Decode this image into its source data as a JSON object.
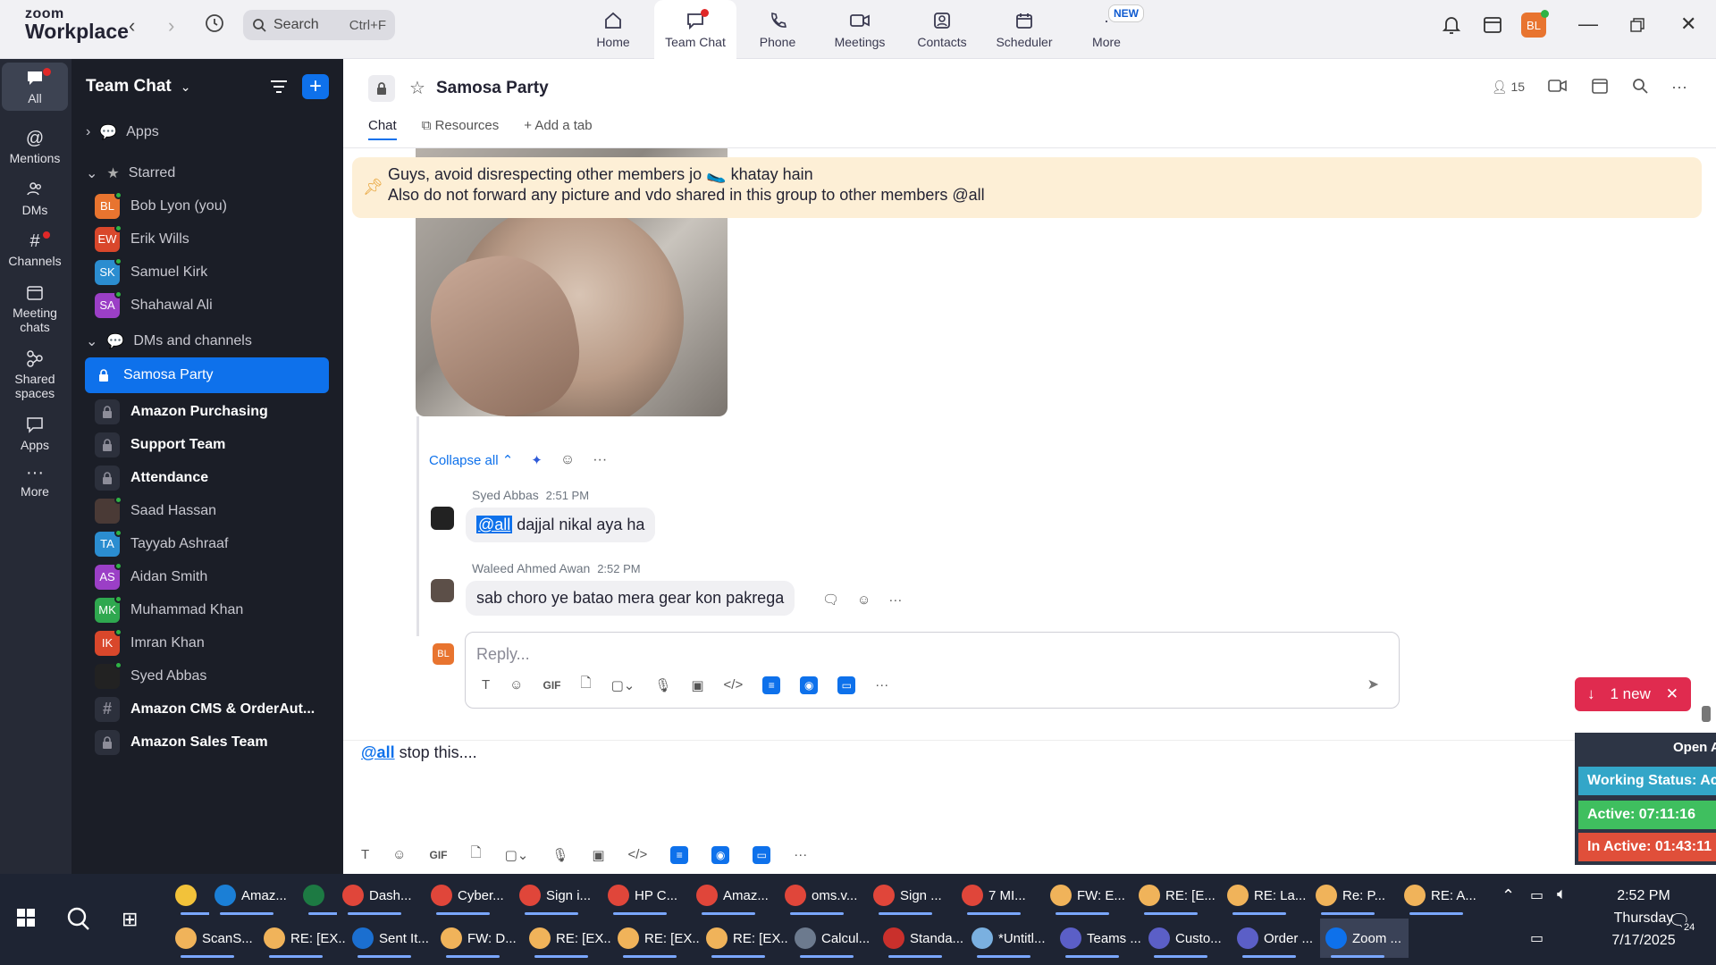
{
  "app": {
    "logo_line1": "zoom",
    "logo_line2": "Workplace",
    "search_placeholder": "Search",
    "search_shortcut": "Ctrl+F",
    "avatar_initials": "BL"
  },
  "top_tabs": [
    {
      "label": "Home",
      "icon": "home-icon"
    },
    {
      "label": "Team Chat",
      "icon": "chat-icon",
      "active": true
    },
    {
      "label": "Phone",
      "icon": "phone-icon"
    },
    {
      "label": "Meetings",
      "icon": "video-icon"
    },
    {
      "label": "Contacts",
      "icon": "contacts-icon"
    },
    {
      "label": "Scheduler",
      "icon": "calendar-icon"
    },
    {
      "label": "More",
      "icon": "more-icon",
      "badge": "NEW"
    }
  ],
  "rail": [
    {
      "label": "All"
    },
    {
      "label": "Mentions"
    },
    {
      "label": "DMs"
    },
    {
      "label": "Channels"
    },
    {
      "label": "Meeting chats"
    },
    {
      "label": "Shared spaces"
    },
    {
      "label": "Apps"
    },
    {
      "label": "More"
    }
  ],
  "sidebar": {
    "title": "Team Chat",
    "apps_label": "Apps",
    "starred_label": "Starred",
    "starred": [
      {
        "initials": "BL",
        "name": "Bob Lyon (you)",
        "color": "#e8742f"
      },
      {
        "initials": "EW",
        "name": "Erik Wills",
        "color": "#d9472b"
      },
      {
        "initials": "SK",
        "name": "Samuel Kirk",
        "color": "#2b8dd0"
      },
      {
        "initials": "SA",
        "name": "Shahawal Ali",
        "color": "#9b3fc6"
      }
    ],
    "dms_label": "DMs and channels",
    "items": [
      {
        "type": "channel",
        "name": "Samosa Party",
        "selected": true
      },
      {
        "type": "channel",
        "name": "Amazon Purchasing",
        "bold": true
      },
      {
        "type": "channel",
        "name": "Support Team",
        "bold": true
      },
      {
        "type": "channel",
        "name": "Attendance",
        "bold": true
      },
      {
        "type": "dm",
        "initials": "",
        "name": "Saad Hassan",
        "color": "#4a3a36"
      },
      {
        "type": "dm",
        "initials": "TA",
        "name": "Tayyab Ashraaf",
        "color": "#2b8dd0"
      },
      {
        "type": "dm",
        "initials": "AS",
        "name": "Aidan Smith",
        "color": "#9b3fc6"
      },
      {
        "type": "dm",
        "initials": "MK",
        "name": "Muhammad Khan",
        "color": "#2fa84f"
      },
      {
        "type": "dm",
        "initials": "IK",
        "name": "Imran Khan",
        "color": "#d9472b"
      },
      {
        "type": "dm",
        "initials": "",
        "name": "Syed Abbas",
        "color": "#222"
      },
      {
        "type": "hash",
        "name": "Amazon CMS & OrderAut...",
        "bold": true
      },
      {
        "type": "channel",
        "name": "Amazon Sales Team",
        "bold": true
      }
    ]
  },
  "channel": {
    "name": "Samosa Party",
    "members": "15",
    "tabs": [
      "Chat",
      "Resources",
      "Add a tab"
    ],
    "pinned_line1": "Guys, avoid disrespecting other members jo 🥿 khatay hain",
    "pinned_line2": "Also do not forward any picture and vdo shared in this group to other members @all",
    "collapse_label": "Collapse all",
    "messages": [
      {
        "author": "Syed Abbas",
        "time": "2:51 PM",
        "mention": "@all",
        "text": " dajjal nikal aya ha"
      },
      {
        "author": "Waleed Ahmed Awan",
        "time": "2:52 PM",
        "text": "sab choro ye batao mera gear kon pakrega"
      }
    ],
    "reply_placeholder": "Reply...",
    "reply_avatar": "BL",
    "new_pill": "1 new",
    "compose_mention": "@all",
    "compose_text": " stop this...."
  },
  "status_panel": {
    "open": "Open A",
    "working": "Working Status: Acti",
    "active": "Active: 07:11:16",
    "inactive": "In Active: 01:43:11"
  },
  "taskbar": {
    "row1": [
      {
        "label": "",
        "color": "#f2c23a"
      },
      {
        "label": "Amaz...",
        "color": "#1b7fd6"
      },
      {
        "label": "",
        "color": "#1d7a43"
      },
      {
        "label": "Dash...",
        "color": "#e0463a"
      },
      {
        "label": "Cyber...",
        "color": "#e0463a"
      },
      {
        "label": "Sign i...",
        "color": "#e0463a"
      },
      {
        "label": "HP C...",
        "color": "#e0463a"
      },
      {
        "label": "Amaz...",
        "color": "#e0463a"
      },
      {
        "label": "oms.v...",
        "color": "#e0463a"
      },
      {
        "label": "Sign ...",
        "color": "#e0463a"
      },
      {
        "label": "7 MI...",
        "color": "#e0463a"
      },
      {
        "label": "FW: E...",
        "color": "#f0b35a"
      },
      {
        "label": "RE: [E...",
        "color": "#f0b35a"
      },
      {
        "label": "RE: La...",
        "color": "#f0b35a"
      },
      {
        "label": "Re: P...",
        "color": "#f0b35a"
      },
      {
        "label": "RE: A...",
        "color": "#f0b35a"
      }
    ],
    "row2": [
      {
        "label": "ScanS...",
        "color": "#f0b35a"
      },
      {
        "label": "RE: [EX...",
        "color": "#f0b35a"
      },
      {
        "label": "Sent It...",
        "color": "#1b6fd0"
      },
      {
        "label": "FW: D...",
        "color": "#f0b35a"
      },
      {
        "label": "RE: [EX...",
        "color": "#f0b35a"
      },
      {
        "label": "RE: [EX...",
        "color": "#f0b35a"
      },
      {
        "label": "RE: [EX...",
        "color": "#f0b35a"
      },
      {
        "label": "Calcul...",
        "color": "#6c7a8e"
      },
      {
        "label": "Standa...",
        "color": "#c9302c"
      },
      {
        "label": "*Untitl...",
        "color": "#7ab0e0"
      },
      {
        "label": "Teams ...",
        "color": "#5b5fc7"
      },
      {
        "label": "Custo...",
        "color": "#5b5fc7"
      },
      {
        "label": "Order ...",
        "color": "#5b5fc7"
      },
      {
        "label": "Zoom ...",
        "color": "#0e71eb",
        "active": true
      }
    ],
    "time": "2:52 PM",
    "day": "Thursday",
    "date": "7/17/2025",
    "notif_count": "24"
  }
}
